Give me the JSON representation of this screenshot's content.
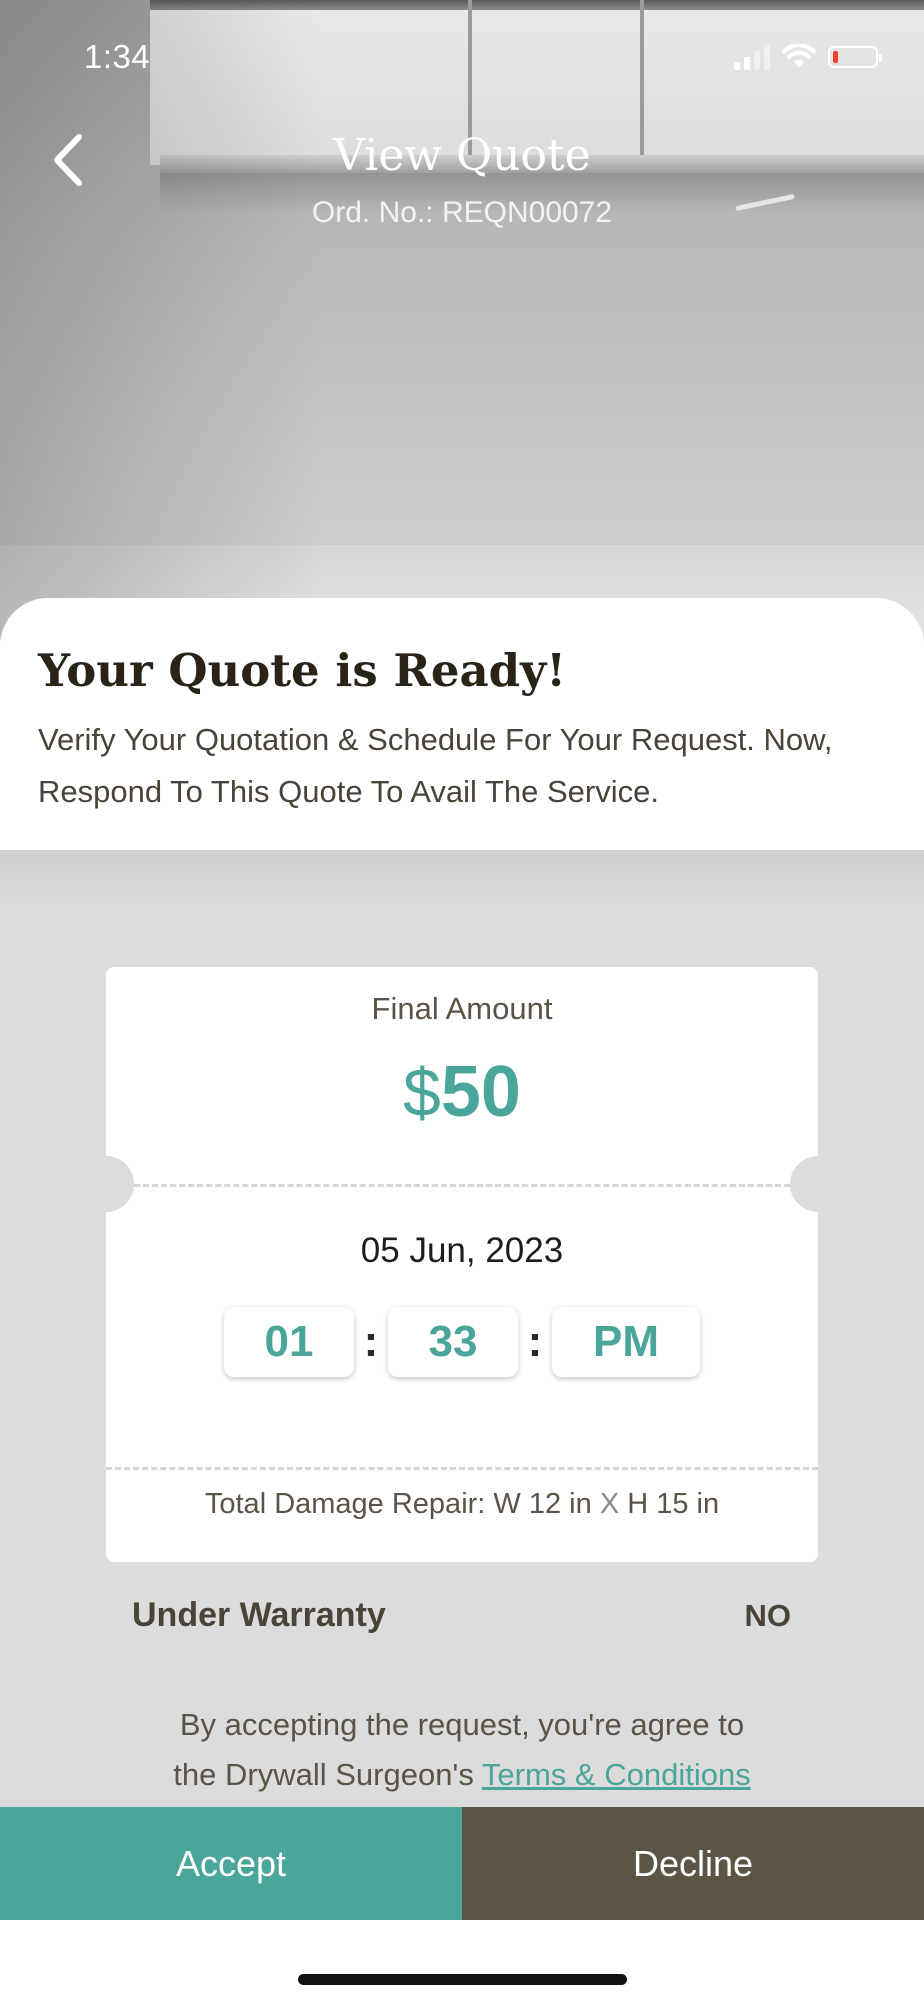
{
  "status_bar": {
    "time": "1:34"
  },
  "header": {
    "title": "View Quote",
    "order_number": "Ord. No.: REQN00072",
    "back_icon": "chevron-left-icon"
  },
  "intro": {
    "title": "Your Quote is Ready!",
    "description": "Verify Your Quotation & Schedule For Your Request. Now, Respond To This Quote To Avail The Service."
  },
  "quote": {
    "final_amount_label": "Final Amount",
    "currency": "$",
    "amount": "50",
    "date": "05 Jun, 2023",
    "hour": "01",
    "minute": "33",
    "period": "PM",
    "time_separator": ":",
    "damage_label": "Total Damage Repair:",
    "damage_width": "W 12 in",
    "damage_x": "X",
    "damage_height": "H 15 in"
  },
  "warranty": {
    "label": "Under Warranty",
    "value": "NO"
  },
  "terms": {
    "line1": "By accepting the request, you're agree to",
    "line2_prefix": "the Drywall Surgeon's",
    "link": "Terms & Conditions"
  },
  "actions": {
    "accept": "Accept",
    "decline": "Decline"
  },
  "colors": {
    "accent": "#4aa59a",
    "decline": "#5c5546",
    "text_dark": "#2a2418"
  }
}
